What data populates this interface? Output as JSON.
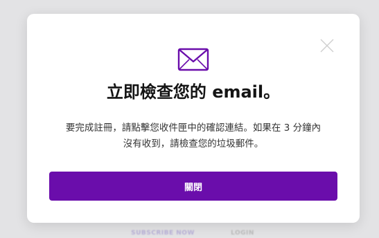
{
  "background_nav": {
    "subscribe_label": "SUBSCRIBE NOW",
    "login_label": "LOGIN"
  },
  "modal": {
    "title": "立即檢查您的 email。",
    "message_line1": "要完成註冊，請點擊您收件匣中的確認連結。如果在 3 分鐘內",
    "message_line2": "沒有收到，請檢查您的垃圾郵件。",
    "close_button_label": "關閉",
    "icons": {
      "close": "close-icon",
      "mail": "envelope-icon"
    },
    "colors": {
      "accent": "#6a0dab",
      "title": "#141414"
    }
  }
}
